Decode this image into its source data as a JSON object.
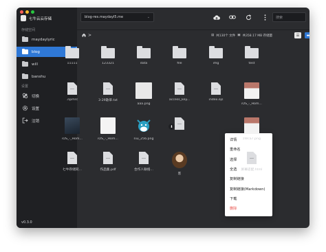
{
  "app": {
    "title": "七牛云云存储",
    "version": "v0.3.0"
  },
  "colors": {
    "accent": "#2f78d6",
    "danger": "#e8504a",
    "close": "#ff5f57",
    "minimize": "#febc2e",
    "maximize": "#28c840"
  },
  "sidebar": {
    "section_buckets": "存储空间",
    "buckets": [
      {
        "label": "maydaylyric",
        "active": false
      },
      {
        "label": "blog",
        "active": true
      },
      {
        "label": "will",
        "active": false
      },
      {
        "label": "banshu",
        "active": false
      }
    ],
    "section_settings": "设置",
    "settings": [
      {
        "label": "切换",
        "icon": "switch-icon"
      },
      {
        "label": "设置",
        "icon": "gear-icon"
      },
      {
        "label": "注销",
        "icon": "logout-icon"
      }
    ]
  },
  "toolbar": {
    "bucket_value": "blog-res.maydayI5.me",
    "search_placeholder": "搜索",
    "icons": [
      "upload-icon",
      "link-icon",
      "refresh-icon",
      "more-icon"
    ]
  },
  "path": {
    "stats": [
      "共130个 文件",
      "共358.17 MB 存储量"
    ]
  },
  "files": [
    {
      "name": "11111",
      "type": "folder"
    },
    {
      "name": "123321",
      "type": "folder"
    },
    {
      "name": "data",
      "type": "folder"
    },
    {
      "name": "file",
      "type": "folder"
    },
    {
      "name": "img",
      "type": "folder"
    },
    {
      "name": "test",
      "type": "folder"
    },
    {
      "name": ".npmrc",
      "type": "file"
    },
    {
      "name": "3-29歌单.txt",
      "type": "file"
    },
    {
      "name": "aaa.png",
      "type": "blank-image"
    },
    {
      "name": "access_key...",
      "type": "file"
    },
    {
      "name": "index.ejs",
      "type": "file"
    },
    {
      "name": "iOS_-_Hom...",
      "type": "image-light"
    },
    {
      "name": "iOS_-_Hom...",
      "type": "image-dark"
    },
    {
      "name": "iOS_-_Hom...",
      "type": "image-doc"
    },
    {
      "name": "niu_256.png",
      "type": "image-cow"
    },
    {
      "name": "",
      "type": "file-selected"
    },
    {
      "name": "",
      "type": "hidden"
    },
    {
      "name": "zWca7.png",
      "type": "image-light"
    },
    {
      "name": "七牛存储同...",
      "type": "file"
    },
    {
      "name": "作品集.pdf",
      "type": "file"
    },
    {
      "name": "合作人联络...",
      "type": "file"
    },
    {
      "name": "客",
      "type": "image-avatar"
    },
    {
      "name": "",
      "type": "hidden"
    },
    {
      "name": "屏幕适配.html",
      "type": "file"
    }
  ],
  "context_menu": [
    {
      "label": "详情",
      "danger": false
    },
    {
      "label": "重命名",
      "danger": false
    },
    {
      "label": "选择",
      "danger": false
    },
    {
      "label": "全选",
      "danger": false
    },
    {
      "label": "复制链接",
      "danger": false
    },
    {
      "label": "复制链接(Markdown)",
      "danger": false
    },
    {
      "label": "下载",
      "danger": false
    },
    {
      "label": "删除",
      "danger": true
    }
  ]
}
